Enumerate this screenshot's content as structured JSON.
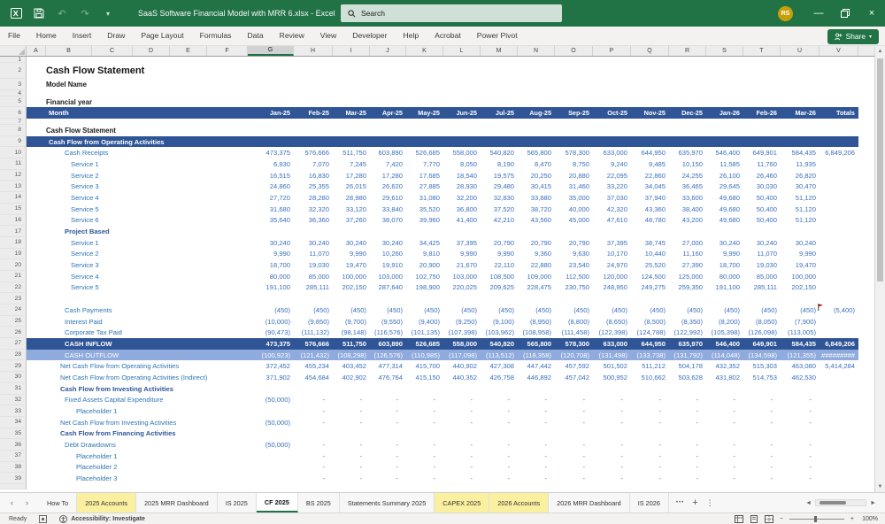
{
  "title_bar": {
    "title": "SaaS Software Financial Model with MRR 6.xlsx -  Excel",
    "search_placeholder": "Search",
    "avatar_initials": "RS",
    "quick_access_icons": [
      "excel-icon",
      "save-icon",
      "undo-icon",
      "redo-icon",
      "customize-quick-access-icon"
    ],
    "window_icons": [
      "minimize-icon",
      "restore-icon",
      "close-icon"
    ]
  },
  "menu": {
    "tabs": [
      "File",
      "Home",
      "Insert",
      "Draw",
      "Page Layout",
      "Formulas",
      "Data",
      "Review",
      "View",
      "Developer",
      "Help",
      "Acrobat",
      "Power Pivot"
    ],
    "share_label": "Share"
  },
  "sheet": {
    "columns": [
      "A",
      "B",
      "C",
      "D",
      "E",
      "F",
      "G",
      "H",
      "I",
      "J",
      "K",
      "L",
      "M",
      "N",
      "O",
      "P",
      "Q",
      "R",
      "S",
      "T",
      "U",
      "V"
    ],
    "selected_column": "G",
    "months": [
      "Jan-25",
      "Feb-25",
      "Mar-25",
      "Apr-25",
      "May-25",
      "Jun-25",
      "Jul-25",
      "Aug-25",
      "Sep-25",
      "Oct-25",
      "Nov-25",
      "Dec-25",
      "Jan-26",
      "Feb-26",
      "Mar-26",
      "Totals"
    ],
    "rows": [
      {
        "n": 1,
        "style": "spacer",
        "label": ""
      },
      {
        "n": 2,
        "style": "title",
        "label": "Cash Flow Statement"
      },
      {
        "n": 3,
        "style": "bold3",
        "label": "Model Name"
      },
      {
        "n": 4,
        "style": "spacer",
        "label": ""
      },
      {
        "n": 5,
        "style": "bold5",
        "label": "Financial year"
      },
      {
        "n": 6,
        "style": "monthbar",
        "label": "Month"
      },
      {
        "n": 7,
        "style": "spacer",
        "label": ""
      },
      {
        "n": 8,
        "style": "bold",
        "label": "Cash Flow Statement"
      },
      {
        "n": 9,
        "style": "sectionbar",
        "label": "Cash Flow from Operating Activities"
      },
      {
        "n": 10,
        "style": "label",
        "label": "Cash Receipts",
        "values": [
          "473,375",
          "576,666",
          "511,750",
          "603,890",
          "526,685",
          "558,000",
          "540,820",
          "565,800",
          "578,300",
          "633,000",
          "644,950",
          "635,970",
          "546,400",
          "649,901",
          "584,435",
          "6,849,206"
        ]
      },
      {
        "n": 11,
        "style": "svc",
        "label": "Service 1",
        "values": [
          "6,930",
          "7,070",
          "7,245",
          "7,420",
          "7,770",
          "8,050",
          "8,190",
          "8,470",
          "8,750",
          "9,240",
          "9,485",
          "10,150",
          "11,585",
          "11,760",
          "11,935",
          ""
        ]
      },
      {
        "n": 12,
        "style": "svc",
        "label": "Service 2",
        "values": [
          "16,515",
          "16,830",
          "17,280",
          "17,280",
          "17,685",
          "18,540",
          "19,575",
          "20,250",
          "20,880",
          "22,095",
          "22,860",
          "24,255",
          "26,100",
          "26,460",
          "26,820",
          ""
        ]
      },
      {
        "n": 13,
        "style": "svc",
        "label": "Service 3",
        "values": [
          "24,860",
          "25,355",
          "26,015",
          "26,620",
          "27,885",
          "28,930",
          "29,480",
          "30,415",
          "31,460",
          "33,220",
          "34,045",
          "36,465",
          "29,645",
          "30,030",
          "30,470",
          ""
        ]
      },
      {
        "n": 14,
        "style": "svc",
        "label": "Service 4",
        "values": [
          "27,720",
          "28,280",
          "28,980",
          "29,610",
          "31,080",
          "32,200",
          "32,830",
          "33,880",
          "35,000",
          "37,030",
          "37,940",
          "33,600",
          "49,680",
          "50,400",
          "51,120",
          ""
        ]
      },
      {
        "n": 15,
        "style": "svc",
        "label": "Service 5",
        "values": [
          "31,680",
          "32,320",
          "33,120",
          "33,840",
          "35,520",
          "36,800",
          "37,520",
          "38,720",
          "40,000",
          "42,320",
          "43,360",
          "38,400",
          "49,680",
          "50,400",
          "51,120",
          ""
        ]
      },
      {
        "n": 16,
        "style": "svc",
        "label": "Service 6",
        "values": [
          "35,640",
          "36,360",
          "37,260",
          "38,070",
          "39,960",
          "41,400",
          "42,210",
          "43,560",
          "45,000",
          "47,610",
          "48,780",
          "43,200",
          "49,680",
          "50,400",
          "51,120",
          ""
        ]
      },
      {
        "n": 17,
        "style": "subhead",
        "label": "Project Based"
      },
      {
        "n": 18,
        "style": "svc",
        "label": "Service 1",
        "values": [
          "30,240",
          "30,240",
          "30,240",
          "30,240",
          "34,425",
          "37,395",
          "20,790",
          "20,790",
          "20,790",
          "37,395",
          "38,745",
          "27,000",
          "30,240",
          "30,240",
          "30,240",
          ""
        ]
      },
      {
        "n": 19,
        "style": "svc",
        "label": "Service 2",
        "values": [
          "9,990",
          "11,070",
          "9,990",
          "10,260",
          "9,810",
          "9,990",
          "9,990",
          "9,360",
          "9,630",
          "10,170",
          "10,440",
          "11,160",
          "9,990",
          "11,070",
          "9,990",
          ""
        ]
      },
      {
        "n": 20,
        "style": "svc",
        "label": "Service 3",
        "values": [
          "18,700",
          "19,030",
          "19,470",
          "19,910",
          "20,900",
          "21,670",
          "22,110",
          "22,880",
          "23,540",
          "24,970",
          "25,520",
          "27,390",
          "18,700",
          "19,030",
          "19,470",
          ""
        ]
      },
      {
        "n": 21,
        "style": "svc",
        "label": "Service 4",
        "values": [
          "80,000",
          "85,000",
          "100,000",
          "103,000",
          "102,750",
          "103,000",
          "108,500",
          "109,000",
          "112,500",
          "120,000",
          "124,500",
          "125,000",
          "80,000",
          "85,000",
          "100,000",
          ""
        ]
      },
      {
        "n": 22,
        "style": "svc",
        "label": "Service 5",
        "values": [
          "191,100",
          "285,111",
          "202,150",
          "287,640",
          "198,900",
          "220,025",
          "209,625",
          "228,475",
          "230,750",
          "248,950",
          "249,275",
          "259,350",
          "191,100",
          "285,111",
          "202,150",
          ""
        ]
      },
      {
        "n": 23,
        "style": "blank",
        "label": ""
      },
      {
        "n": 24,
        "style": "label",
        "label": "Cash Payments",
        "flag": true,
        "values": [
          "(450)",
          "(450)",
          "(450)",
          "(450)",
          "(450)",
          "(450)",
          "(450)",
          "(450)",
          "(450)",
          "(450)",
          "(450)",
          "(450)",
          "(450)",
          "(450)",
          "(450)",
          "(5,400)"
        ]
      },
      {
        "n": 25,
        "style": "label",
        "label": "Interest Paid",
        "values": [
          "(10,000)",
          "(9,850)",
          "(9,700)",
          "(9,550)",
          "(9,400)",
          "(9,250)",
          "(9,100)",
          "(8,950)",
          "(8,800)",
          "(8,650)",
          "(8,500)",
          "(8,350)",
          "(8,200)",
          "(8,050)",
          "(7,900)",
          ""
        ]
      },
      {
        "n": 26,
        "style": "label",
        "label": "Corporate Tax Paid",
        "values": [
          "(90,473)",
          "(111,132)",
          "(98,148)",
          "(116,576)",
          "(101,135)",
          "(107,398)",
          "(103,962)",
          "(108,958)",
          "(111,458)",
          "(122,398)",
          "(124,788)",
          "(122,992)",
          "(105,398)",
          "(126,098)",
          "(113,005)",
          ""
        ]
      },
      {
        "n": 27,
        "style": "inflow",
        "label": "CASH INFLOW",
        "values": [
          "473,375",
          "576,666",
          "511,750",
          "603,890",
          "526,685",
          "558,000",
          "540,820",
          "565,800",
          "578,300",
          "633,000",
          "644,950",
          "635,970",
          "546,400",
          "649,901",
          "584,435",
          "6,849,206"
        ]
      },
      {
        "n": 28,
        "style": "outflow",
        "label": "CASH OUTFLOW",
        "values": [
          "(100,923)",
          "(121,432)",
          "(108,298)",
          "(126,576)",
          "(110,985)",
          "(117,098)",
          "(113,512)",
          "(118,358)",
          "(120,708)",
          "(131,498)",
          "(133,738)",
          "(131,792)",
          "(114,048)",
          "(134,598)",
          "(121,355)",
          "#########"
        ]
      },
      {
        "n": 29,
        "style": "net",
        "label": "Net Cash Flow from Operating Activities",
        "values": [
          "372,452",
          "455,234",
          "403,452",
          "477,314",
          "415,700",
          "440,902",
          "427,308",
          "447,442",
          "457,592",
          "501,502",
          "511,212",
          "504,178",
          "432,352",
          "515,303",
          "463,080",
          "5,414,284"
        ]
      },
      {
        "n": 30,
        "style": "net",
        "label": "Net Cash Flow from Operating Activities (Indirect)",
        "values": [
          "371,902",
          "454,684",
          "402,902",
          "476,764",
          "415,150",
          "440,352",
          "426,758",
          "446,892",
          "457,042",
          "500,952",
          "510,662",
          "503,628",
          "431,802",
          "514,753",
          "462,530",
          ""
        ]
      },
      {
        "n": 31,
        "style": "secthead",
        "label": "Cash Flow from Investing Activities"
      },
      {
        "n": 32,
        "style": "label",
        "label": "Fixed Assets Capital Expenditure",
        "values": [
          "(50,000)",
          "-",
          "-",
          "-",
          "-",
          "-",
          "-",
          "-",
          "-",
          "-",
          "-",
          "-",
          "-",
          "-",
          "-",
          ""
        ]
      },
      {
        "n": 33,
        "style": "ph",
        "label": "Placeholder 1",
        "values": [
          "",
          "-",
          "-",
          "-",
          "-",
          "-",
          "-",
          "-",
          "-",
          "-",
          "-",
          "-",
          "-",
          "-",
          "-",
          ""
        ]
      },
      {
        "n": 34,
        "style": "net",
        "label": "Net Cash Flow from Investing Activities",
        "values": [
          "(50,000)",
          "-",
          "-",
          "-",
          "-",
          "-",
          "-",
          "-",
          "-",
          "-",
          "-",
          "-",
          "-",
          "-",
          "-",
          ""
        ]
      },
      {
        "n": 35,
        "style": "secthead",
        "label": "Cash Flow from Financing Activities"
      },
      {
        "n": 36,
        "style": "label",
        "label": "Debt Drawdowns",
        "values": [
          "(50,000)",
          "-",
          "-",
          "-",
          "-",
          "-",
          "-",
          "-",
          "-",
          "-",
          "-",
          "-",
          "-",
          "-",
          "-",
          ""
        ]
      },
      {
        "n": 37,
        "style": "ph",
        "label": "Placeholder 1",
        "values": [
          "",
          "-",
          "-",
          "-",
          "-",
          "-",
          "-",
          "-",
          "-",
          "-",
          "-",
          "-",
          "-",
          "-",
          "-",
          ""
        ]
      },
      {
        "n": 38,
        "style": "ph",
        "label": "Placeholder 2",
        "values": [
          "",
          "-",
          "-",
          "-",
          "-",
          "-",
          "-",
          "-",
          "-",
          "-",
          "-",
          "-",
          "-",
          "-",
          "-",
          ""
        ]
      },
      {
        "n": 39,
        "style": "ph",
        "label": "Placeholder 3",
        "values": [
          "",
          "-",
          "-",
          "-",
          "-",
          "-",
          "-",
          "-",
          "-",
          "-",
          "-",
          "-",
          "-",
          "-",
          "-",
          ""
        ]
      },
      {
        "n": 40,
        "style": "clipped",
        "label": ""
      }
    ]
  },
  "sheet_tabs": {
    "tabs": [
      {
        "label": "How To"
      },
      {
        "label": "2025 Accounts",
        "highlight": true
      },
      {
        "label": "2025 MRR Dashboard"
      },
      {
        "label": "IS 2025"
      },
      {
        "label": "CF 2025",
        "active": true
      },
      {
        "label": "BS 2025"
      },
      {
        "label": "Statements Summary 2025"
      },
      {
        "label": "CAPEX 2025",
        "highlight": true
      },
      {
        "label": "2026 Accounts",
        "highlight": true
      },
      {
        "label": "2026 MRR Dashboard"
      },
      {
        "label": "IS 2026"
      }
    ],
    "overflow_label": "•••",
    "add_label": "+",
    "more_label": "⋮"
  },
  "status_bar": {
    "ready": "Ready",
    "accessibility": "Accessibility: Investigate",
    "zoom": "100%"
  },
  "colors": {
    "excel_green": "#217346",
    "bar_dark_blue": "#2F5597",
    "bar_light_blue": "#8FAADC",
    "value_blue": "#3a6fc0",
    "tab_yellow": "#FBF0A0"
  }
}
